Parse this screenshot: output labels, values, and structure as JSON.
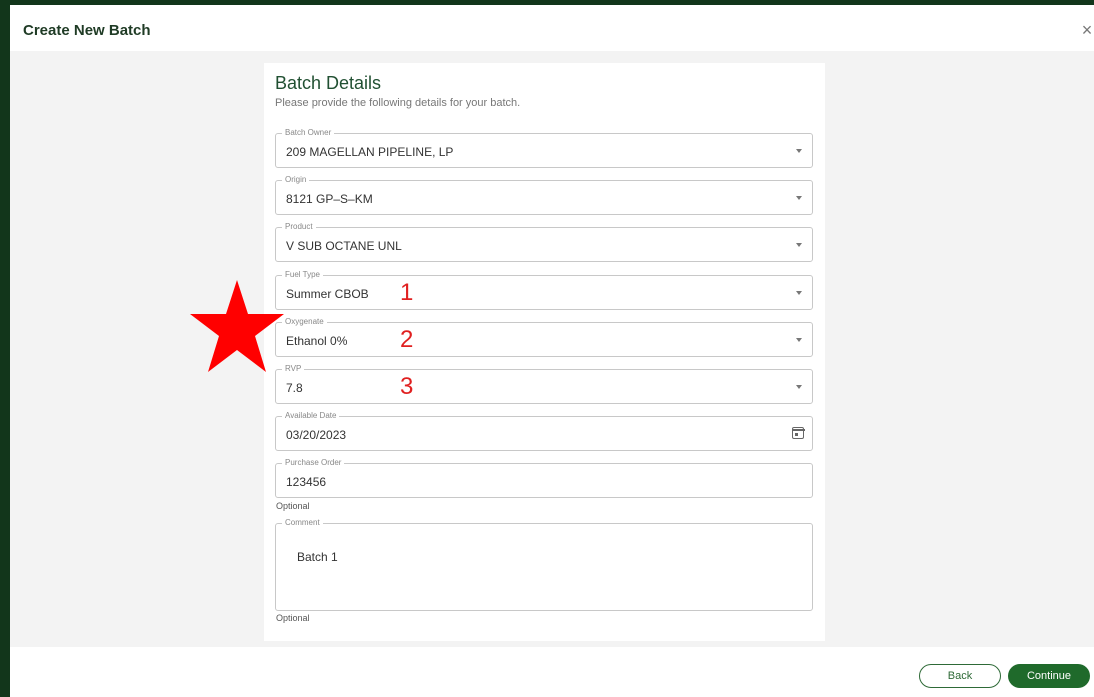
{
  "dialog": {
    "title": "Create New Batch",
    "close_label": "×"
  },
  "card": {
    "title": "Batch Details",
    "subtitle": "Please provide the following details for your batch."
  },
  "fields": {
    "batch_owner": {
      "label": "Batch Owner",
      "value": "209 MAGELLAN PIPELINE, LP"
    },
    "origin": {
      "label": "Origin",
      "value": "8121 GP–S–KM"
    },
    "product": {
      "label": "Product",
      "value": "V SUB OCTANE UNL"
    },
    "fuel_type": {
      "label": "Fuel Type",
      "value": "Summer CBOB"
    },
    "oxygenate": {
      "label": "Oxygenate",
      "value": "Ethanol 0%"
    },
    "rvp": {
      "label": "RVP",
      "value": "7.8"
    },
    "available_date": {
      "label": "Available Date",
      "value": "03/20/2023"
    },
    "purchase_order": {
      "label": "Purchase Order",
      "value": "123456",
      "helper": "Optional"
    },
    "comment": {
      "label": "Comment",
      "value": "Batch 1",
      "helper": "Optional"
    }
  },
  "annotations": {
    "marker_1": "1",
    "marker_2": "2",
    "marker_3": "3",
    "star_color": "#ff0000"
  },
  "footer": {
    "back_label": "Back",
    "continue_label": "Continue"
  },
  "colors": {
    "accent": "#1f6a2b",
    "frame": "#12361b"
  }
}
